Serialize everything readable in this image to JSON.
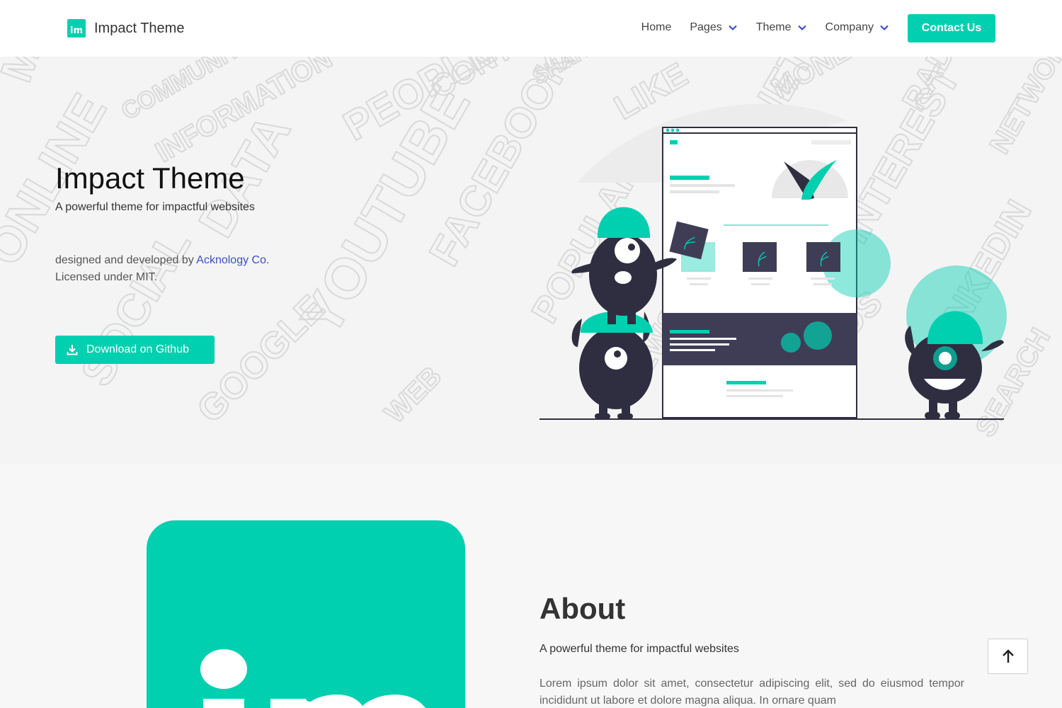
{
  "navbar": {
    "brand_logo_text": "im",
    "brand_text": "Impact Theme",
    "items": [
      {
        "label": "Home",
        "has_dropdown": false
      },
      {
        "label": "Pages",
        "has_dropdown": true
      },
      {
        "label": "Theme",
        "has_dropdown": true
      },
      {
        "label": "Company",
        "has_dropdown": true
      }
    ],
    "contact_label": "Contact Us"
  },
  "hero": {
    "title": "Impact Theme",
    "subtitle": "A powerful theme for impactful websites",
    "credit_prefix": "designed and developed by ",
    "credit_link": "Acknology Co.",
    "credit_license": "Licensed under MIT.",
    "download_label": "Download on Github",
    "bg_words": [
      "MOBILE",
      "COMMUNITY",
      "INFORMATION",
      "PEOPLE",
      "CONTENT",
      "SHARE",
      "LIKE",
      "MONEY",
      "RADIO",
      "NETWORK",
      "DATA",
      "YOUTUBE",
      "FACEBOOK",
      "POPULAR",
      "ONLINE",
      "SOCIAL",
      "INTERNET",
      "PINTEREST",
      "LINKEDIN",
      "NEWS",
      "WEB",
      "FRIENDS",
      "SEARCH",
      "GOOGLE"
    ]
  },
  "about": {
    "logo_text": "im",
    "title": "About",
    "subtitle": "A powerful theme for impactful websites",
    "lorem": "Lorem ipsum dolor sit amet, consectetur adipiscing elit, sed do eiusmod tempor incididunt ut labore et dolore magna aliqua. In ornare quam"
  },
  "icons": {
    "chevron": "chevron-down-icon",
    "download": "download-icon",
    "scroll_top": "arrow-up-icon"
  },
  "colors": {
    "accent": "#00cfb0",
    "link": "#3b4fc4",
    "dark": "#2f2e41"
  }
}
